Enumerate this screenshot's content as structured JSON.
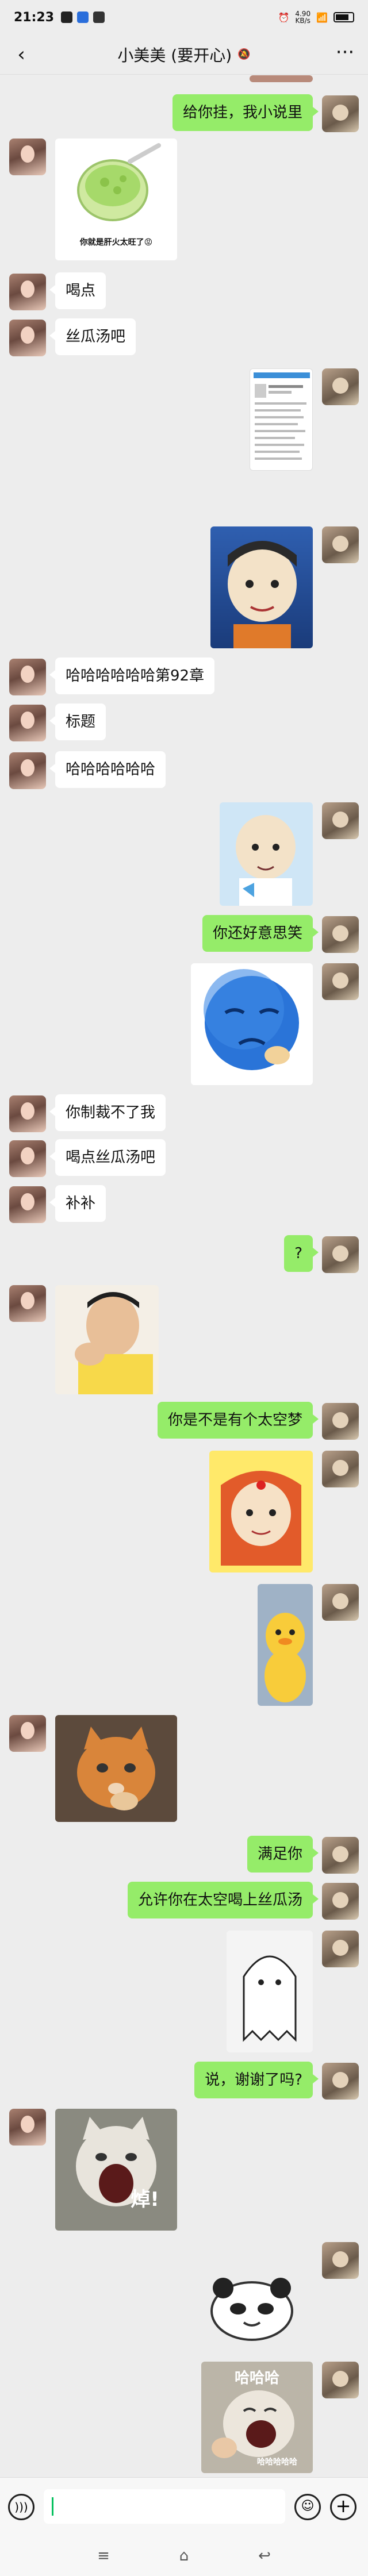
{
  "status": {
    "time": "21:23",
    "net_speed": "4.90",
    "net_unit": "KB/s",
    "battery": "58"
  },
  "header": {
    "back": "‹",
    "title": "小美美 (要开心)",
    "mute_icon": "🔕",
    "more": "···"
  },
  "messages": [
    {
      "side": "right",
      "type": "text",
      "text": "给你挂，我小说里"
    },
    {
      "side": "left",
      "type": "sticker",
      "icon": "green-soup-bowl-sticker",
      "caption": "你就是肝火太旺了😡"
    },
    {
      "side": "left",
      "type": "text",
      "text": "喝点"
    },
    {
      "side": "left",
      "type": "text",
      "text": "丝瓜汤吧"
    },
    {
      "side": "right",
      "type": "image",
      "icon": "novel-chapter-screenshot"
    },
    {
      "side": "right",
      "type": "sticker",
      "icon": "cartoon-boy-sticker"
    },
    {
      "side": "left",
      "type": "text",
      "text": "哈哈哈哈哈哈第92章"
    },
    {
      "side": "left",
      "type": "text",
      "text": "标题"
    },
    {
      "side": "left",
      "type": "text",
      "text": "哈哈哈哈哈哈"
    },
    {
      "side": "right",
      "type": "sticker",
      "icon": "cartoon-kid-blue-sticker"
    },
    {
      "side": "right",
      "type": "text",
      "text": "你还好意思笑"
    },
    {
      "side": "right",
      "type": "sticker",
      "icon": "blue-smiley-sticker"
    },
    {
      "side": "left",
      "type": "text",
      "text": "你制裁不了我"
    },
    {
      "side": "left",
      "type": "text",
      "text": "喝点丝瓜汤吧"
    },
    {
      "side": "left",
      "type": "text",
      "text": "补补"
    },
    {
      "side": "right",
      "type": "text",
      "text": "?"
    },
    {
      "side": "left",
      "type": "sticker",
      "icon": "man-photo-sticker"
    },
    {
      "side": "right",
      "type": "text",
      "text": "你是不是有个太空梦"
    },
    {
      "side": "right",
      "type": "sticker",
      "icon": "cartoon-red-kid-sticker"
    },
    {
      "side": "right",
      "type": "sticker",
      "icon": "yellow-duck-sticker"
    },
    {
      "side": "left",
      "type": "sticker",
      "icon": "orange-cat-sticker"
    },
    {
      "side": "right",
      "type": "text",
      "text": "满足你"
    },
    {
      "side": "right",
      "type": "text",
      "text": "允许你在太空喝上丝瓜汤"
    },
    {
      "side": "right",
      "type": "sticker",
      "icon": "ghost-sticker"
    },
    {
      "side": "right",
      "type": "text",
      "text": "说，谢谢了吗?"
    },
    {
      "side": "left",
      "type": "sticker",
      "icon": "screaming-cat-sticker",
      "caption": "焯!"
    },
    {
      "side": "right",
      "type": "sticker",
      "icon": "panda-sticker"
    },
    {
      "side": "right",
      "type": "sticker",
      "icon": "laughing-cat-sticker",
      "caption": "哈哈哈",
      "caption2": "哈哈哈哈哈"
    }
  ],
  "input": {
    "voice_icon": "voice-icon",
    "emoji_icon": "emoji-icon",
    "plus_icon": "plus-icon"
  },
  "system_nav": {
    "menu": "≡",
    "home": "⌂",
    "back": "↩"
  }
}
